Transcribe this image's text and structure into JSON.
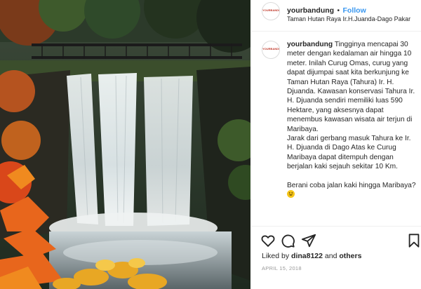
{
  "post": {
    "username": "yourbandung",
    "separator": "•",
    "follow_label": "Follow",
    "location": "Taman Hutan Raya Ir.H.Juanda-Dago Pakar",
    "avatar_text": "YOURBANDUNG"
  },
  "caption": {
    "username": "yourbandung",
    "p1": "Tingginya mencapai 30 meter dengan kedalaman air hingga 10 meter. Inilah Curug Omas, curug yang dapat dijumpai saat kita berkunjung ke Taman Hutan Raya (Tahura) Ir. H. Djuanda. Kawasan konservasi Tahura Ir. H. Djuanda sendiri memiliki luas 590 Hektare, yang aksesnya dapat menembus kawasan wisata air terjun di Maribaya.",
    "p2": "Jarak dari gerbang masuk Tahura ke Ir. H. Djuanda di Dago Atas ke Curug Maribaya dapat ditempuh dengan berjalan kaki sejauh sekitar 10 Km.",
    "p3": "Berani coba jalan kaki hingga Maribaya?"
  },
  "likes": {
    "prefix": "Liked by ",
    "user": "dina8122",
    "middle": " and ",
    "others": "others"
  },
  "date": "APRIL 15, 2018",
  "icons": [
    "heart-icon",
    "comment-icon",
    "share-icon",
    "bookmark-icon"
  ],
  "colors": {
    "follow": "#3897f0",
    "text": "#262626",
    "date": "#999999"
  }
}
